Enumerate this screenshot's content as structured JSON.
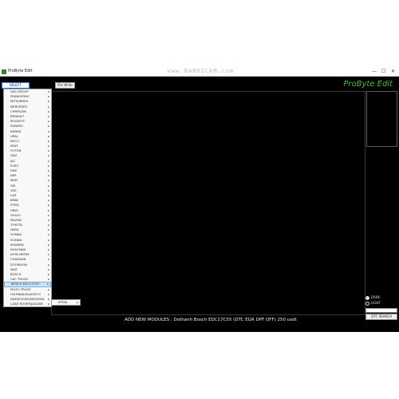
{
  "window": {
    "title": "ProByte Edit",
    "watermark": "www.BANDICAM.com",
    "minimize": "—",
    "maximize": "☐",
    "close": "✕"
  },
  "toolbar": {
    "select_label": "SELECT VEHICLES",
    "file_label": "File Write"
  },
  "brand": "ProByte Edit",
  "menu_items": [
    {
      "label": "VAG GROUP"
    },
    {
      "label": "SSANGYONG"
    },
    {
      "label": "MITSUBISHI"
    },
    {
      "label": "MERCEDES"
    },
    {
      "label": "CHRYSLER"
    },
    {
      "label": "RENAULT"
    },
    {
      "label": "PEUGEOT"
    },
    {
      "label": "SUBARU"
    },
    {
      "label": "KAMAZ"
    },
    {
      "label": "URAL"
    },
    {
      "label": "PACCI"
    },
    {
      "label": "SEAT"
    },
    {
      "label": "FOTON"
    },
    {
      "label": "GAZ"
    },
    {
      "label": "JAC"
    },
    {
      "label": "FUSO"
    },
    {
      "label": "FAW"
    },
    {
      "label": "DAF"
    },
    {
      "label": "MAN"
    },
    {
      "label": "GM"
    },
    {
      "label": "VAZ"
    },
    {
      "label": "LAZ"
    },
    {
      "label": "BMW"
    },
    {
      "label": "FORD"
    },
    {
      "label": "HINO"
    },
    {
      "label": "VOLVO"
    },
    {
      "label": "MAZDA"
    },
    {
      "label": "TOYOTA"
    },
    {
      "label": "FAMIL"
    },
    {
      "label": "HONDA"
    },
    {
      "label": "SCANIA"
    },
    {
      "label": "SHAMAN"
    },
    {
      "label": "SHACMAN"
    },
    {
      "label": "JOHN DEERE"
    },
    {
      "label": "CHANGAN"
    },
    {
      "label": "ZOOMLION"
    },
    {
      "label": "MAZ"
    },
    {
      "label": "BOSCH"
    },
    {
      "label": "CAC TRUCK"
    },
    {
      "label": "BOSCH EDC17C55"
    },
    {
      "label": "ISUZU TRUCK"
    },
    {
      "label": "HYUNDAI/KIA/IVECO"
    },
    {
      "label": "DAEWOO/SSANGYONG"
    },
    {
      "label": "LAND ROVER/JAGUAR"
    }
  ],
  "active_index": 39,
  "submenu": {
    "item": "EPDEL"
  },
  "radios": [
    {
      "label": "DARK",
      "selected": true
    },
    {
      "label": "LIGHT",
      "selected": false
    }
  ],
  "dtc_button": "DTC SEARCH",
  "status_text": "ADD NEW MODULES : Dothanh Bosch EDC17C55 (DTC EGR DPF OFF) 250 usdt"
}
